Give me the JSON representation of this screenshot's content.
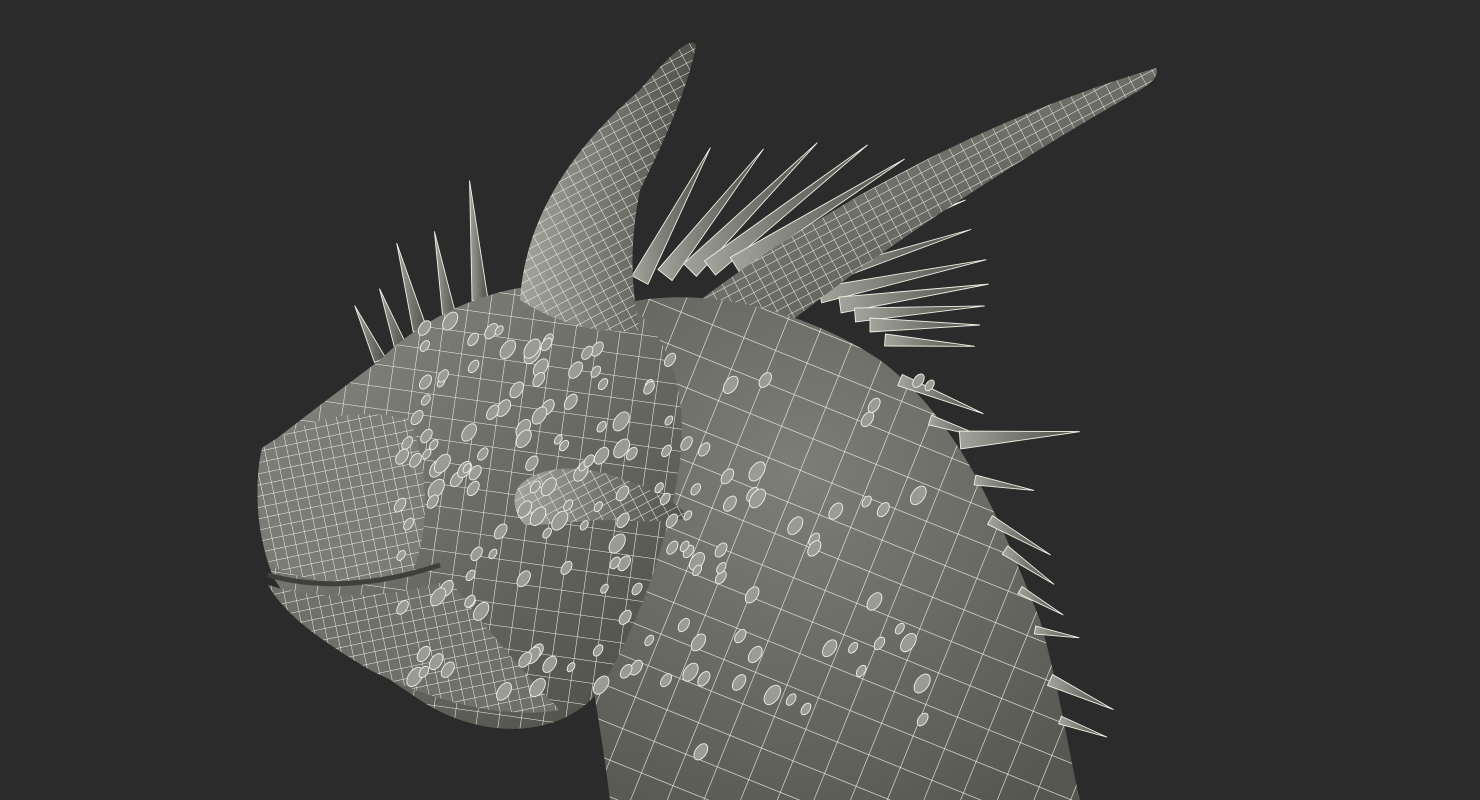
{
  "viewport": {
    "background_color": "#2b2b2b",
    "model": {
      "subject": "dragon-head",
      "surface_color": "#6b6c65",
      "surface_shadow_color": "#4a4b45",
      "surface_highlight_color": "#9a9b93",
      "wireframe_color": "#f1efe4",
      "shading": "wireframe-on-shaded"
    }
  }
}
